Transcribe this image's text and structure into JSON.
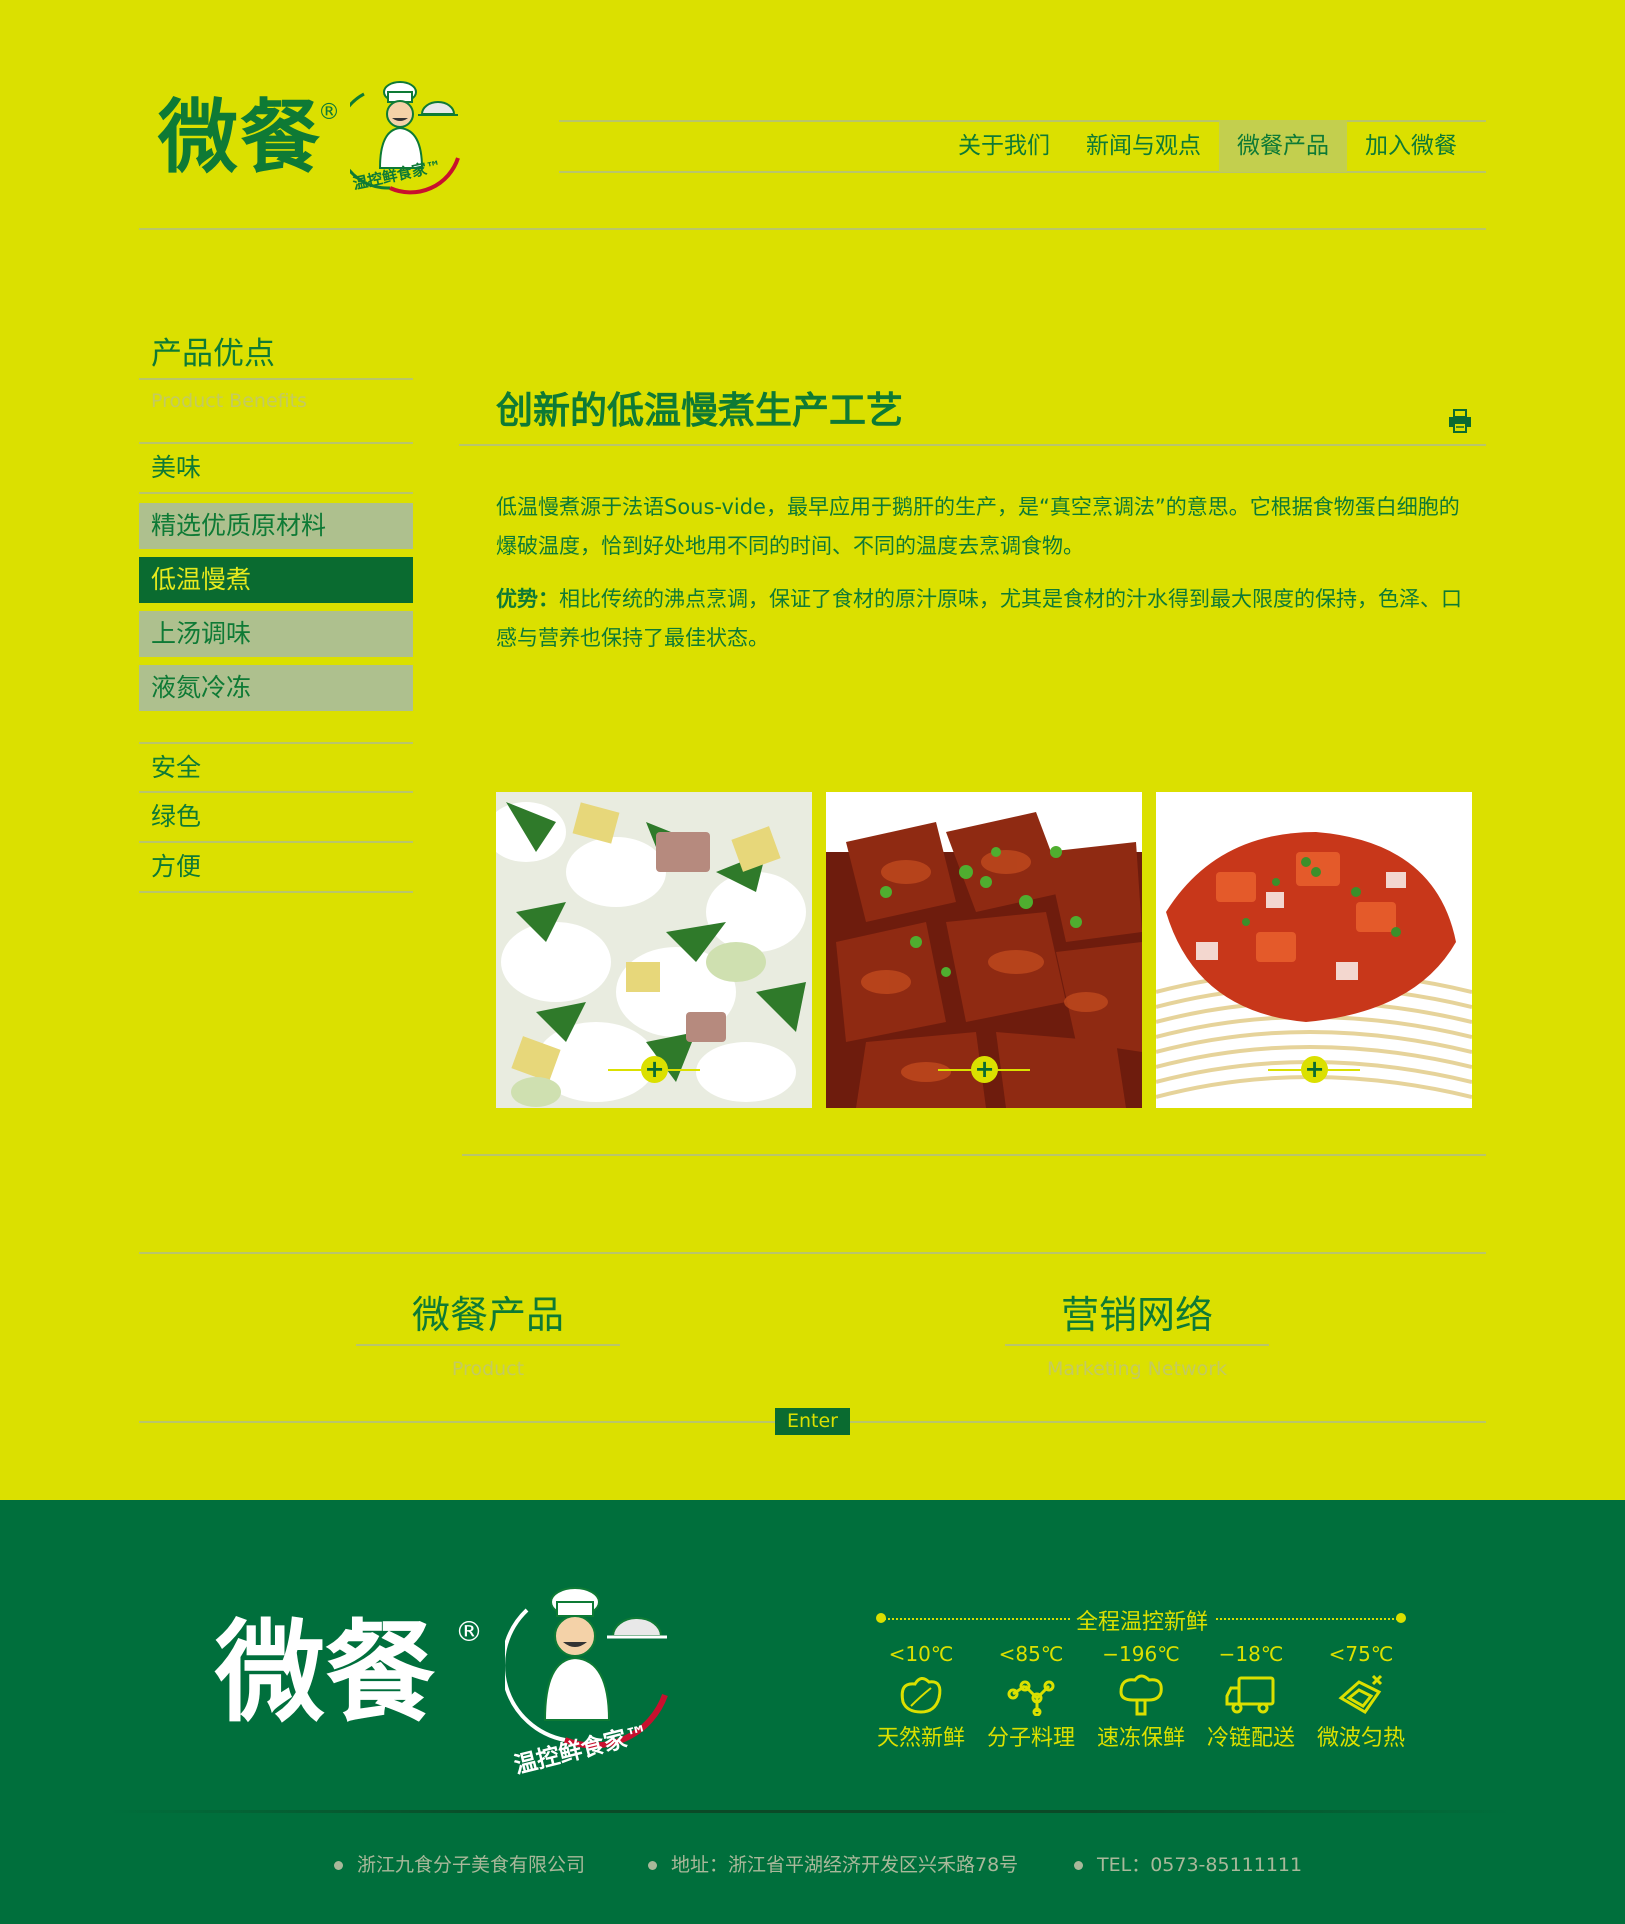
{
  "header": {
    "logo_text": "微餐",
    "logo_reg": "®",
    "logo_tagline": "温控鲜食家™",
    "nav": [
      {
        "label": "关于我们"
      },
      {
        "label": "新闻与观点"
      },
      {
        "label": "微餐产品",
        "active": true
      },
      {
        "label": "加入微餐"
      }
    ]
  },
  "sidebar": {
    "title": "产品优点",
    "subtitle": "Product Benefits",
    "items": [
      {
        "label": "美味"
      },
      {
        "label": "精选优质原材料"
      },
      {
        "label": "低温慢煮",
        "active": true
      },
      {
        "label": "上汤调味"
      },
      {
        "label": "液氮冷冻"
      },
      {
        "label": "安全"
      },
      {
        "label": "绿色"
      },
      {
        "label": "方便"
      }
    ]
  },
  "main": {
    "title": "创新的低温慢煮生产工艺",
    "paragraph1": "低温慢煮源于法语Sous-vide，最早应用于鹅肝的生产，是“真空烹调法”的意思。它根据食物蛋白细胞的爆破温度，恰到好处地用不同的时间、不同的温度去烹调食物。",
    "advantage_label": "优势：",
    "paragraph2": "相比传统的沸点烹调，保证了食材的原汁原味，尤其是食材的汁水得到最大限度的保持，色泽、口感与营养也保持了最佳状态。",
    "photos_expand_symbol": "+"
  },
  "sections": {
    "product_title": "微餐产品",
    "product_sub": "Product",
    "network_title": "营销网络",
    "network_sub": "Marketing Network",
    "enter_label": "Enter"
  },
  "footer": {
    "logo_text": "微餐",
    "logo_reg": "®",
    "logo_tagline": "温控鲜食家™",
    "features_title": "全程温控新鲜",
    "features": [
      {
        "temp": "<10℃",
        "name": "天然新鲜",
        "icon": "leaf-icon"
      },
      {
        "temp": "<85℃",
        "name": "分子料理",
        "icon": "molecule-icon"
      },
      {
        "temp": "−196℃",
        "name": "速冻保鲜",
        "icon": "freeze-icon"
      },
      {
        "temp": "−18℃",
        "name": "冷链配送",
        "icon": "truck-icon"
      },
      {
        "temp": "<75℃",
        "name": "微波匀热",
        "icon": "microwave-icon"
      }
    ],
    "company": "浙江九食分子美食有限公司",
    "address": "地址：浙江省平湖经济开发区兴禾路78号",
    "tel": "TEL：0573-85111111"
  }
}
